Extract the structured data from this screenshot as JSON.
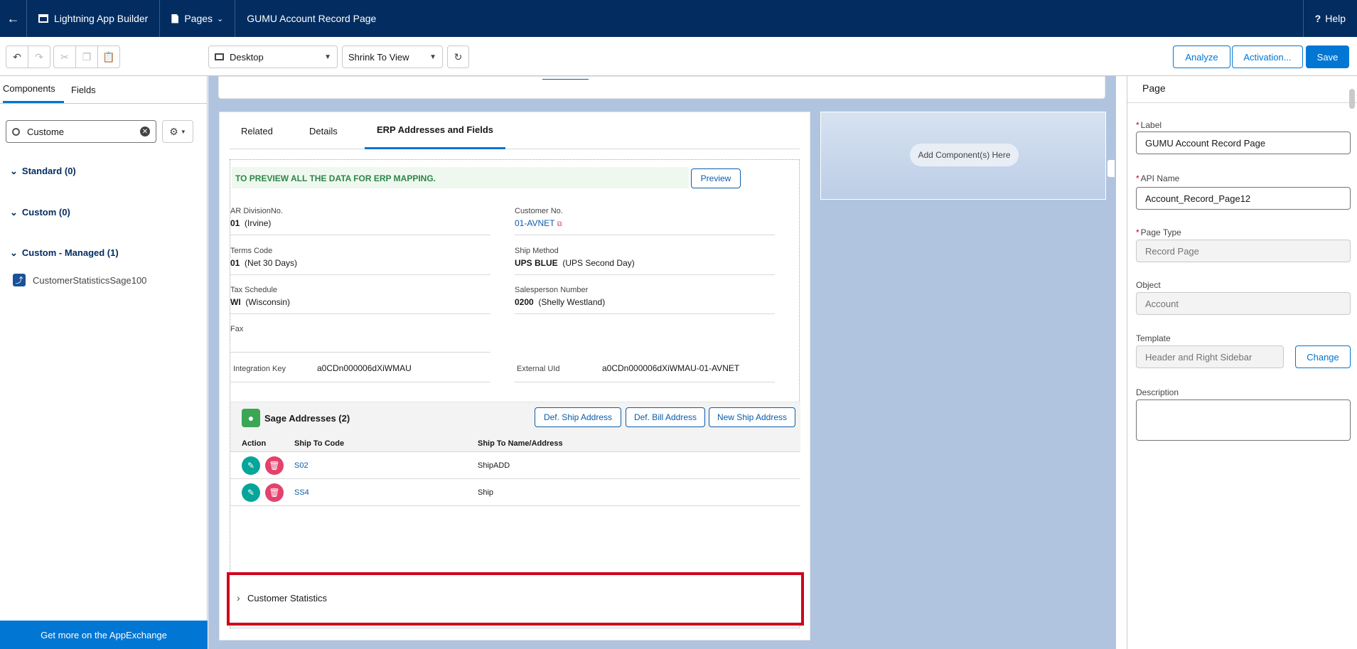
{
  "topbar": {
    "back_icon": "back-arrow-icon",
    "app_name": "Lightning App Builder",
    "pages_label": "Pages",
    "page_title": "GUMU Account Record Page",
    "help_label": "Help"
  },
  "toolbar": {
    "view_select": "Desktop",
    "zoom_select": "Shrink To View",
    "analyze_label": "Analyze",
    "activation_label": "Activation...",
    "save_label": "Save"
  },
  "left": {
    "tabs": [
      "Components",
      "Fields"
    ],
    "search_value": "Custome",
    "sections": [
      {
        "label": "Standard (0)"
      },
      {
        "label": "Custom (0)"
      },
      {
        "label": "Custom - Managed (1)"
      }
    ],
    "component_item": "CustomerStatisticsSage100",
    "appexchange_label": "Get more on the AppExchange"
  },
  "main": {
    "tabs": [
      "Related",
      "Details",
      "ERP Addresses and Fields"
    ],
    "banner_text": "TO PREVIEW ALL THE DATA FOR ERP MAPPING.",
    "preview_label": "Preview",
    "fields": {
      "ar_division_label": "AR DivisionNo.",
      "ar_division_code": "01",
      "ar_division_name": "(Irvine)",
      "customer_no_label": "Customer No.",
      "customer_no_value": "01-AVNET",
      "terms_code_label": "Terms Code",
      "terms_code_code": "01",
      "terms_code_name": "(Net 30 Days)",
      "ship_method_label": "Ship Method",
      "ship_method_code": "UPS BLUE",
      "ship_method_name": "(UPS Second Day)",
      "tax_schedule_label": "Tax Schedule",
      "tax_schedule_code": "WI",
      "tax_schedule_name": "(Wisconsin)",
      "salesperson_label": "Salesperson Number",
      "salesperson_code": "0200",
      "salesperson_name": "(Shelly Westland)",
      "fax_label": "Fax",
      "integration_key_label": "Integration Key",
      "integration_key_value": "a0CDn000006dXiWMAU",
      "external_uid_label": "External UId",
      "external_uid_value": "a0CDn000006dXiWMAU-01-AVNET"
    },
    "addresses": {
      "title": "Sage Addresses (2)",
      "def_ship_label": "Def. Ship Address",
      "def_bill_label": "Def. Bill Address",
      "new_ship_label": "New Ship Address",
      "columns": [
        "Action",
        "Ship To Code",
        "Ship To Name/Address"
      ],
      "rows": [
        {
          "code": "S02",
          "name": "ShipADD"
        },
        {
          "code": "SS4",
          "name": "Ship"
        }
      ]
    },
    "customer_statistics_label": "Customer Statistics",
    "add_component_label": "Add Component(s) Here"
  },
  "right": {
    "header": "Page",
    "label_label": "Label",
    "label_value": "GUMU Account Record Page",
    "api_name_label": "API Name",
    "api_name_value": "Account_Record_Page12",
    "page_type_label": "Page Type",
    "page_type_value": "Record Page",
    "object_label": "Object",
    "object_value": "Account",
    "template_label": "Template",
    "template_value": "Header and Right Sidebar",
    "change_label": "Change",
    "description_label": "Description"
  },
  "colors": {
    "nav": "#032d60",
    "brand": "#0176d3",
    "highlight": "#d0021b",
    "edit_green": "#06a59a",
    "delete_pink": "#e3426d",
    "banner_green": "#2e844a"
  }
}
